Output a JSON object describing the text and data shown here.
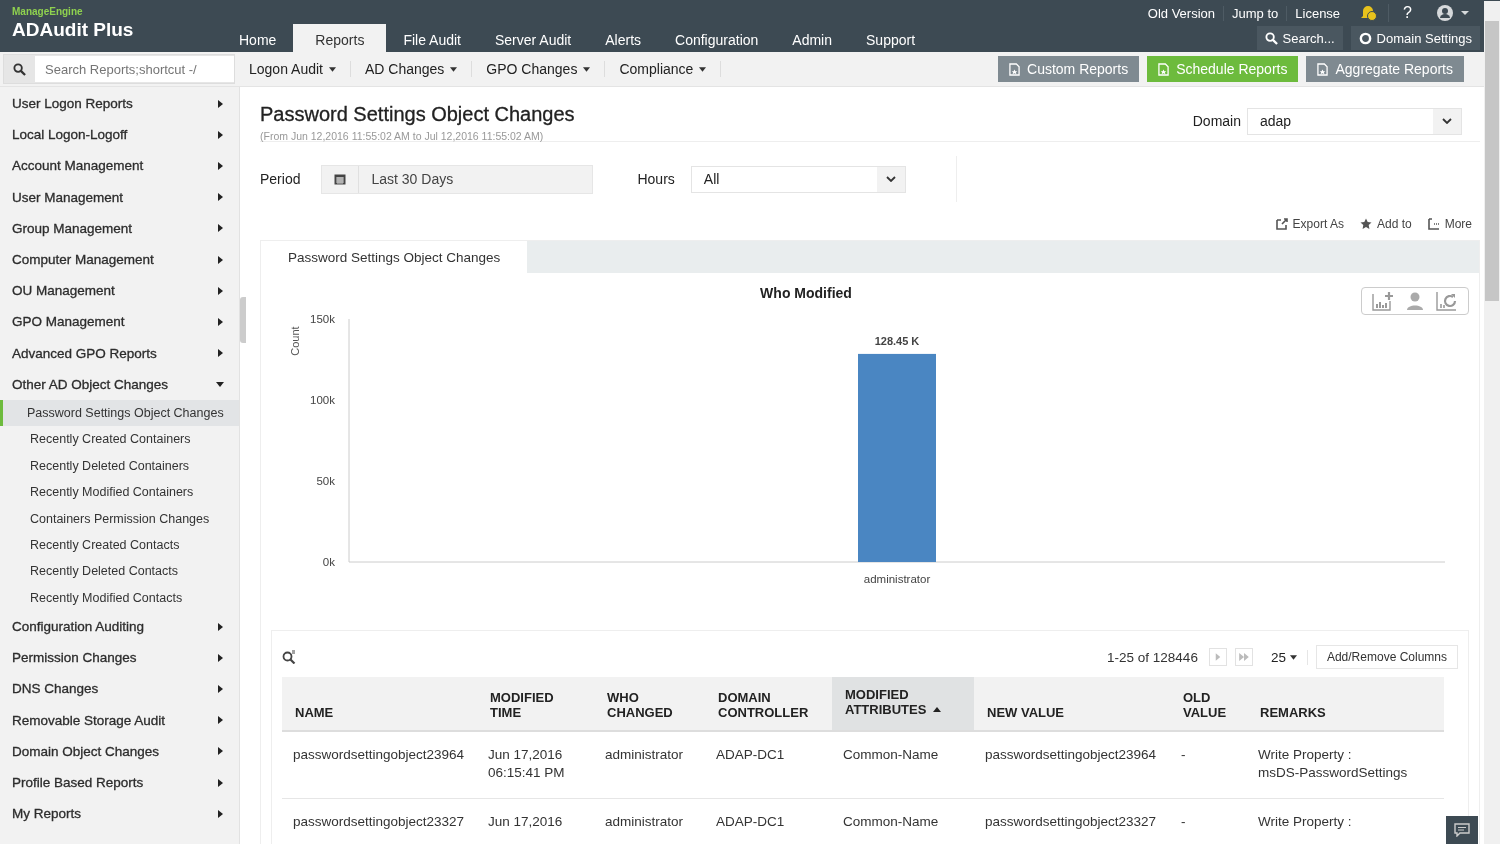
{
  "brand": {
    "vendor": "ManageEngine",
    "product": "ADAudit Plus"
  },
  "top_links": [
    "Old Version",
    "Jump to",
    "License"
  ],
  "help": "?",
  "nav_tabs": [
    {
      "label": "Home",
      "selected": false
    },
    {
      "label": "Reports",
      "selected": true
    },
    {
      "label": "File Audit",
      "selected": false
    },
    {
      "label": "Server Audit",
      "selected": false
    },
    {
      "label": "Alerts",
      "selected": false
    },
    {
      "label": "Configuration",
      "selected": false
    },
    {
      "label": "Admin",
      "selected": false
    },
    {
      "label": "Support",
      "selected": false
    }
  ],
  "header_search": "Search...",
  "domain_settings": "Domain Settings",
  "report_search": {
    "placeholder": "Search Reports;shortcut -/"
  },
  "sub_menus": [
    "Logon Audit",
    "AD Changes",
    "GPO Changes",
    "Compliance"
  ],
  "action_buttons": [
    {
      "label": "Custom Reports",
      "kind": "grey"
    },
    {
      "label": "Schedule Reports",
      "kind": "green"
    },
    {
      "label": "Aggregate Reports",
      "kind": "grey"
    }
  ],
  "sidebar": {
    "items": [
      {
        "label": "User Logon Reports",
        "expanded": false
      },
      {
        "label": "Local Logon-Logoff",
        "expanded": false
      },
      {
        "label": "Account Management",
        "expanded": false
      },
      {
        "label": "User Management",
        "expanded": false
      },
      {
        "label": "Group Management",
        "expanded": false
      },
      {
        "label": "Computer Management",
        "expanded": false
      },
      {
        "label": "OU Management",
        "expanded": false
      },
      {
        "label": "GPO Management",
        "expanded": false
      },
      {
        "label": "Advanced GPO Reports",
        "expanded": false
      },
      {
        "label": "Other AD Object Changes",
        "expanded": true,
        "children": [
          {
            "label": "Password Settings Object Changes",
            "selected": true
          },
          {
            "label": "Recently Created Containers",
            "selected": false
          },
          {
            "label": "Recently Deleted Containers",
            "selected": false
          },
          {
            "label": "Recently Modified Containers",
            "selected": false
          },
          {
            "label": "Containers Permission Changes",
            "selected": false
          },
          {
            "label": "Recently Created Contacts",
            "selected": false
          },
          {
            "label": "Recently Deleted Contacts",
            "selected": false
          },
          {
            "label": "Recently Modified Contacts",
            "selected": false
          }
        ]
      },
      {
        "label": "Configuration Auditing",
        "expanded": false
      },
      {
        "label": "Permission Changes",
        "expanded": false
      },
      {
        "label": "DNS Changes",
        "expanded": false
      },
      {
        "label": "Removable Storage Audit",
        "expanded": false
      },
      {
        "label": "Domain Object Changes",
        "expanded": false
      },
      {
        "label": "Profile Based Reports",
        "expanded": false
      },
      {
        "label": "My Reports",
        "expanded": false
      }
    ]
  },
  "report": {
    "title": "Password Settings Object Changes",
    "range": "(From Jun 12,2016 11:55:02 AM to Jul 12,2016 11:55:02 AM)"
  },
  "domain": {
    "label": "Domain",
    "value": "adap"
  },
  "period": {
    "label": "Period",
    "value": "Last 30 Days"
  },
  "hours": {
    "label": "Hours",
    "value": "All"
  },
  "tools": [
    "Export As",
    "Add to",
    "More"
  ],
  "report_tab": "Password Settings Object Changes",
  "chart": {
    "chart_data": {
      "type": "bar",
      "title": "Who Modified",
      "ylabel": "Count",
      "categories": [
        "administrator"
      ],
      "values": [
        128450
      ],
      "ylim": [
        0,
        150000
      ],
      "yticks": [
        {
          "value": 0,
          "label": "0k"
        },
        {
          "value": 50000,
          "label": "50k"
        },
        {
          "value": 100000,
          "label": "100k"
        },
        {
          "value": 150000,
          "label": "150k"
        }
      ],
      "value_labels": [
        "128.45 K"
      ],
      "color": "#4a86c2"
    }
  },
  "table": {
    "pager": "1-25 of 128446",
    "page_size": "25",
    "columns_button": "Add/Remove Columns",
    "columns": [
      {
        "label": "NAME",
        "sorted": false
      },
      {
        "label": "MODIFIED TIME",
        "sorted": false
      },
      {
        "label": "WHO CHANGED",
        "sorted": false
      },
      {
        "label": "DOMAIN CONTROLLER",
        "sorted": false
      },
      {
        "label": "MODIFIED ATTRIBUTES",
        "sorted": true
      },
      {
        "label": "NEW VALUE",
        "sorted": false
      },
      {
        "label": "OLD VALUE",
        "sorted": false
      },
      {
        "label": "REMARKS",
        "sorted": false
      }
    ],
    "rows": [
      [
        "passwordsettingobject23964",
        [
          "Jun 17,2016",
          "06:15:41 PM"
        ],
        "administrator",
        "ADAP-DC1",
        "Common-Name",
        "passwordsettingobject23964",
        "-",
        [
          "Write Property :",
          "msDS-PasswordSettings"
        ]
      ],
      [
        "passwordsettingobject23327",
        [
          "Jun 17,2016"
        ],
        "administrator",
        "ADAP-DC1",
        "Common-Name",
        "passwordsettingobject23327",
        "-",
        [
          "Write Property :"
        ]
      ]
    ]
  }
}
